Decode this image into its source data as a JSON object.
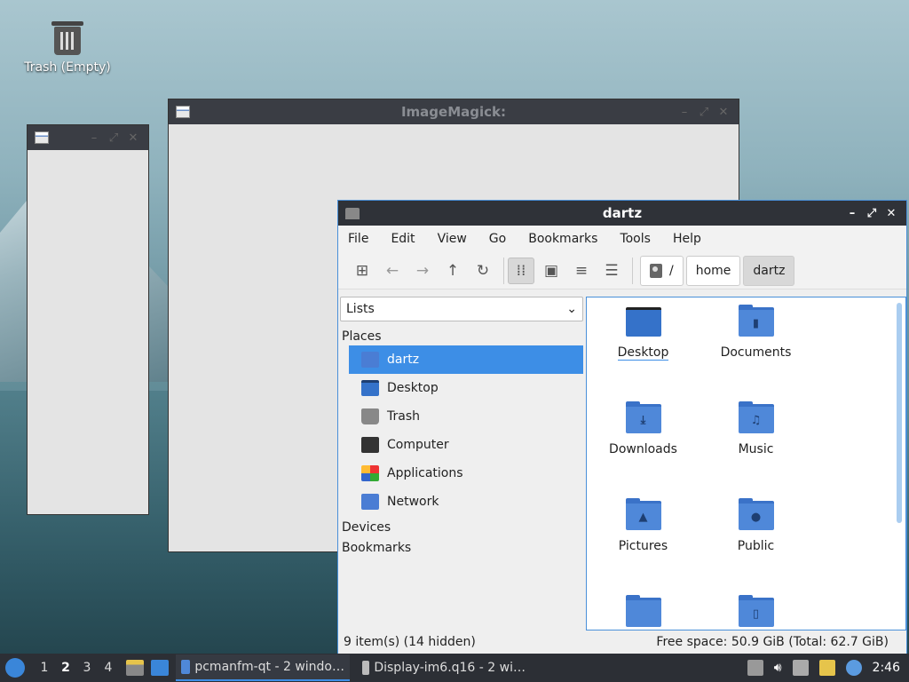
{
  "desktop": {
    "trash_label": "Trash (Empty)"
  },
  "windows": {
    "imagemagick_title": "ImageMagick:",
    "small_title": ""
  },
  "file_manager": {
    "title": "dartz",
    "menu": [
      "File",
      "Edit",
      "View",
      "Go",
      "Bookmarks",
      "Tools",
      "Help"
    ],
    "path": {
      "root": "/",
      "segments": [
        "home",
        "dartz"
      ]
    },
    "side_view_select": "Lists",
    "sections": {
      "places": "Places",
      "devices": "Devices",
      "bookmarks": "Bookmarks"
    },
    "places": [
      {
        "label": "dartz",
        "icon": "home-folder-icon",
        "selected": true
      },
      {
        "label": "Desktop",
        "icon": "desktop-icon",
        "selected": false
      },
      {
        "label": "Trash",
        "icon": "trash-icon",
        "selected": false
      },
      {
        "label": "Computer",
        "icon": "computer-icon",
        "selected": false
      },
      {
        "label": "Applications",
        "icon": "applications-icon",
        "selected": false
      },
      {
        "label": "Network",
        "icon": "network-icon",
        "selected": false
      }
    ],
    "items": [
      {
        "label": "Desktop",
        "icon": "desktop-folder-icon"
      },
      {
        "label": "Documents",
        "icon": "documents-folder-icon"
      },
      {
        "label": "Downloads",
        "icon": "downloads-folder-icon"
      },
      {
        "label": "Music",
        "icon": "music-folder-icon"
      },
      {
        "label": "Pictures",
        "icon": "pictures-folder-icon"
      },
      {
        "label": "Public",
        "icon": "public-folder-icon"
      },
      {
        "label": "",
        "icon": "folder-icon"
      },
      {
        "label": "",
        "icon": "templates-folder-icon"
      }
    ],
    "status": {
      "left": "9 item(s) (14 hidden)",
      "right": "Free space: 50.9 GiB (Total: 62.7 GiB)"
    }
  },
  "taskbar": {
    "workspaces": [
      "1",
      "2",
      "3",
      "4"
    ],
    "current_workspace": "2",
    "tasks": [
      {
        "label": "pcmanfm-qt - 2 windo…",
        "active": true
      },
      {
        "label": "Display-im6.q16 - 2 wi…",
        "active": false
      }
    ],
    "clock": "2:46"
  },
  "colors": {
    "accent": "#3d8ee6",
    "titlebar": "#2f3238"
  }
}
